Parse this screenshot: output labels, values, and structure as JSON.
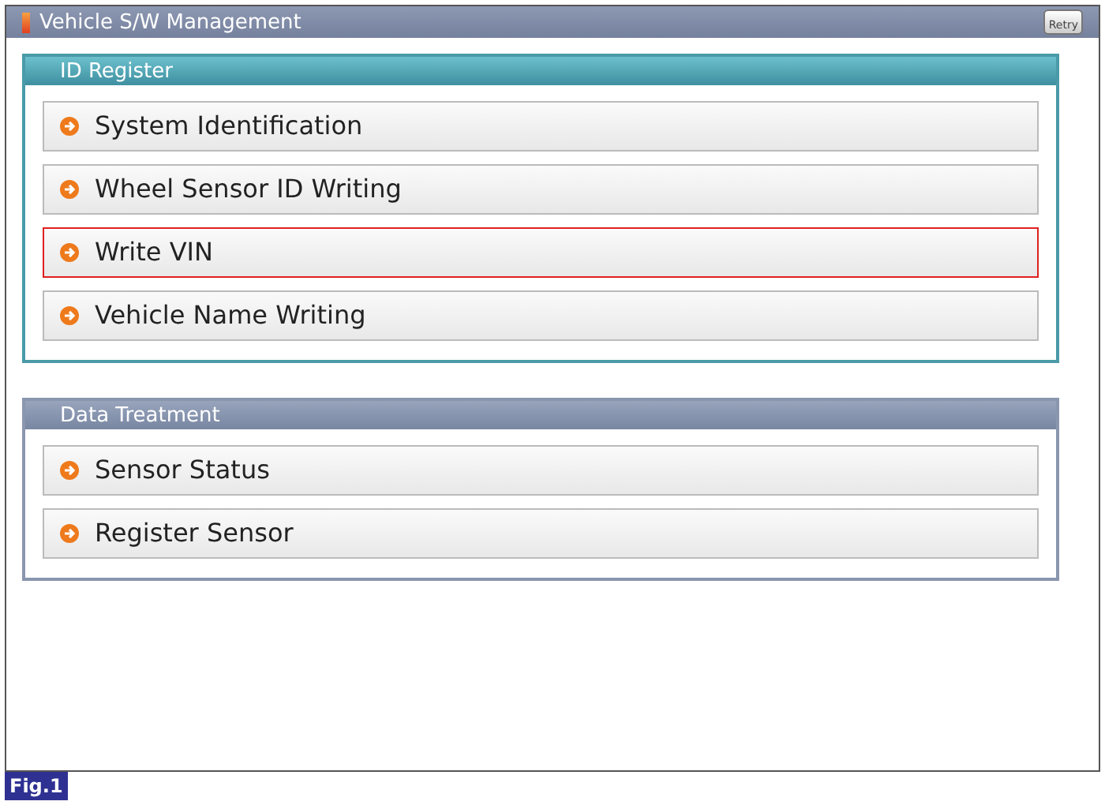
{
  "window": {
    "title": "Vehicle S/W Management",
    "retry_label": "Retry"
  },
  "sections": [
    {
      "kind": "active",
      "title": "ID Register",
      "items": [
        {
          "label": "System Identification",
          "selected": false
        },
        {
          "label": "Wheel Sensor ID Writing",
          "selected": false
        },
        {
          "label": "Write VIN",
          "selected": true
        },
        {
          "label": "Vehicle Name Writing",
          "selected": false
        }
      ]
    },
    {
      "kind": "normal",
      "title": "Data Treatment",
      "items": [
        {
          "label": "Sensor Status",
          "selected": false
        },
        {
          "label": "Register Sensor",
          "selected": false
        }
      ]
    }
  ],
  "figure_label": "Fig.1"
}
